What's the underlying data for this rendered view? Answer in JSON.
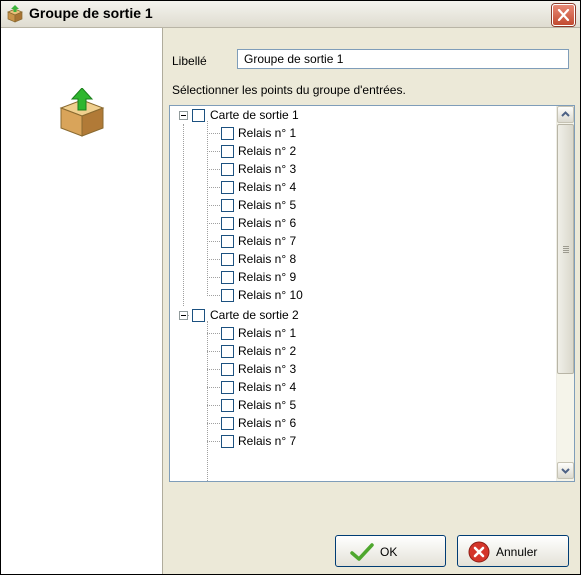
{
  "window": {
    "title": "Groupe de sortie 1",
    "title_icon": "box-icon"
  },
  "form": {
    "libelle_label": "Libellé",
    "libelle_value": "Groupe de sortie 1",
    "instructions": "Sélectionner les points du groupe d'entrées."
  },
  "tree": {
    "groups": [
      {
        "label": "Carte de sortie 1",
        "expanded": true,
        "items": [
          "Relais n° 1",
          "Relais n° 2",
          "Relais n° 3",
          "Relais n° 4",
          "Relais n° 5",
          "Relais n° 6",
          "Relais n° 7",
          "Relais n° 8",
          "Relais n° 9",
          "Relais n° 10"
        ]
      },
      {
        "label": "Carte de sortie 2",
        "expanded": true,
        "items": [
          "Relais n° 1",
          "Relais n° 2",
          "Relais n° 3",
          "Relais n° 4",
          "Relais n° 5",
          "Relais n° 6",
          "Relais n° 7"
        ]
      }
    ]
  },
  "buttons": {
    "ok": "OK",
    "cancel": "Annuler"
  },
  "colors": {
    "window_bg": "#ece9d8",
    "close_red": "#c24a30",
    "ok_green": "#4ea72e",
    "cancel_red": "#d4352a"
  }
}
